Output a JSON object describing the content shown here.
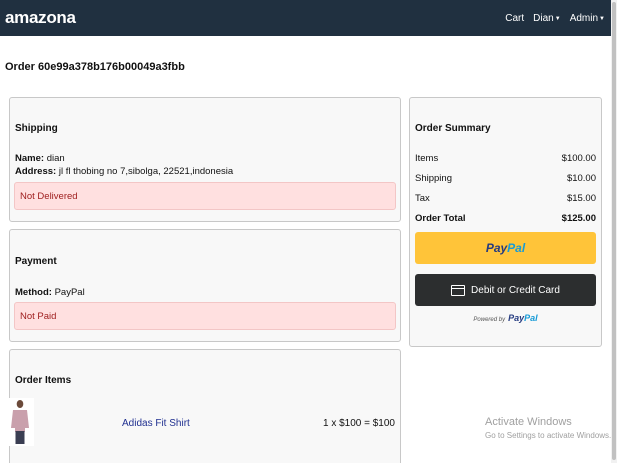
{
  "header": {
    "brand": "amazona",
    "cart": "Cart",
    "user": "Dian",
    "admin": "Admin",
    "background": "#203040"
  },
  "order": {
    "title": "Order 60e99a378b176b00049a3fbb"
  },
  "shipping": {
    "heading": "Shipping",
    "name_label": "Name:",
    "name_value": "dian",
    "address_label": "Address:",
    "address_value": "jl fl thobing no 7,sibolga, 22521,indonesia",
    "status": "Not Delivered"
  },
  "payment": {
    "heading": "Payment",
    "method_label": "Method:",
    "method_value": "PayPal",
    "status": "Not Paid"
  },
  "order_items": {
    "heading": "Order Items",
    "items": [
      {
        "name": "Adidas Fit Shirt",
        "price_line": "1 x $100 = $100",
        "image_icon": "shirt-thumbnail"
      }
    ]
  },
  "summary": {
    "heading": "Order Summary",
    "rows": [
      {
        "label": "Items",
        "value": "$100.00"
      },
      {
        "label": "Shipping",
        "value": "$10.00"
      },
      {
        "label": "Tax",
        "value": "$15.00"
      },
      {
        "label": "Order Total",
        "value": "$125.00"
      }
    ],
    "paypal_button_part1": "Pay",
    "paypal_button_part2": "Pal",
    "card_button": "Debit or Credit Card",
    "powered_by": "Powered by",
    "powered_pp1": "Pay",
    "powered_pp2": "Pal"
  },
  "watermark": {
    "line1": "Activate Windows",
    "line2": "Go to Settings to activate Windows."
  }
}
